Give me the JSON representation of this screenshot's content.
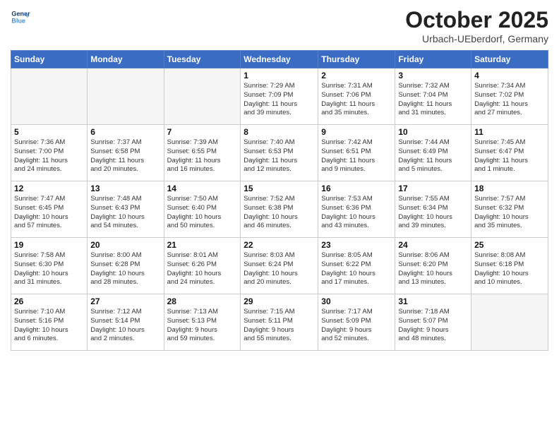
{
  "logo": {
    "text1": "General",
    "text2": "Blue"
  },
  "header": {
    "month": "October 2025",
    "location": "Urbach-UEberdorf, Germany"
  },
  "weekdays": [
    "Sunday",
    "Monday",
    "Tuesday",
    "Wednesday",
    "Thursday",
    "Friday",
    "Saturday"
  ],
  "weeks": [
    [
      {
        "day": "",
        "info": ""
      },
      {
        "day": "",
        "info": ""
      },
      {
        "day": "",
        "info": ""
      },
      {
        "day": "1",
        "info": "Sunrise: 7:29 AM\nSunset: 7:09 PM\nDaylight: 11 hours\nand 39 minutes."
      },
      {
        "day": "2",
        "info": "Sunrise: 7:31 AM\nSunset: 7:06 PM\nDaylight: 11 hours\nand 35 minutes."
      },
      {
        "day": "3",
        "info": "Sunrise: 7:32 AM\nSunset: 7:04 PM\nDaylight: 11 hours\nand 31 minutes."
      },
      {
        "day": "4",
        "info": "Sunrise: 7:34 AM\nSunset: 7:02 PM\nDaylight: 11 hours\nand 27 minutes."
      }
    ],
    [
      {
        "day": "5",
        "info": "Sunrise: 7:36 AM\nSunset: 7:00 PM\nDaylight: 11 hours\nand 24 minutes."
      },
      {
        "day": "6",
        "info": "Sunrise: 7:37 AM\nSunset: 6:58 PM\nDaylight: 11 hours\nand 20 minutes."
      },
      {
        "day": "7",
        "info": "Sunrise: 7:39 AM\nSunset: 6:55 PM\nDaylight: 11 hours\nand 16 minutes."
      },
      {
        "day": "8",
        "info": "Sunrise: 7:40 AM\nSunset: 6:53 PM\nDaylight: 11 hours\nand 12 minutes."
      },
      {
        "day": "9",
        "info": "Sunrise: 7:42 AM\nSunset: 6:51 PM\nDaylight: 11 hours\nand 9 minutes."
      },
      {
        "day": "10",
        "info": "Sunrise: 7:44 AM\nSunset: 6:49 PM\nDaylight: 11 hours\nand 5 minutes."
      },
      {
        "day": "11",
        "info": "Sunrise: 7:45 AM\nSunset: 6:47 PM\nDaylight: 11 hours\nand 1 minute."
      }
    ],
    [
      {
        "day": "12",
        "info": "Sunrise: 7:47 AM\nSunset: 6:45 PM\nDaylight: 10 hours\nand 57 minutes."
      },
      {
        "day": "13",
        "info": "Sunrise: 7:48 AM\nSunset: 6:43 PM\nDaylight: 10 hours\nand 54 minutes."
      },
      {
        "day": "14",
        "info": "Sunrise: 7:50 AM\nSunset: 6:40 PM\nDaylight: 10 hours\nand 50 minutes."
      },
      {
        "day": "15",
        "info": "Sunrise: 7:52 AM\nSunset: 6:38 PM\nDaylight: 10 hours\nand 46 minutes."
      },
      {
        "day": "16",
        "info": "Sunrise: 7:53 AM\nSunset: 6:36 PM\nDaylight: 10 hours\nand 43 minutes."
      },
      {
        "day": "17",
        "info": "Sunrise: 7:55 AM\nSunset: 6:34 PM\nDaylight: 10 hours\nand 39 minutes."
      },
      {
        "day": "18",
        "info": "Sunrise: 7:57 AM\nSunset: 6:32 PM\nDaylight: 10 hours\nand 35 minutes."
      }
    ],
    [
      {
        "day": "19",
        "info": "Sunrise: 7:58 AM\nSunset: 6:30 PM\nDaylight: 10 hours\nand 31 minutes."
      },
      {
        "day": "20",
        "info": "Sunrise: 8:00 AM\nSunset: 6:28 PM\nDaylight: 10 hours\nand 28 minutes."
      },
      {
        "day": "21",
        "info": "Sunrise: 8:01 AM\nSunset: 6:26 PM\nDaylight: 10 hours\nand 24 minutes."
      },
      {
        "day": "22",
        "info": "Sunrise: 8:03 AM\nSunset: 6:24 PM\nDaylight: 10 hours\nand 20 minutes."
      },
      {
        "day": "23",
        "info": "Sunrise: 8:05 AM\nSunset: 6:22 PM\nDaylight: 10 hours\nand 17 minutes."
      },
      {
        "day": "24",
        "info": "Sunrise: 8:06 AM\nSunset: 6:20 PM\nDaylight: 10 hours\nand 13 minutes."
      },
      {
        "day": "25",
        "info": "Sunrise: 8:08 AM\nSunset: 6:18 PM\nDaylight: 10 hours\nand 10 minutes."
      }
    ],
    [
      {
        "day": "26",
        "info": "Sunrise: 7:10 AM\nSunset: 5:16 PM\nDaylight: 10 hours\nand 6 minutes."
      },
      {
        "day": "27",
        "info": "Sunrise: 7:12 AM\nSunset: 5:14 PM\nDaylight: 10 hours\nand 2 minutes."
      },
      {
        "day": "28",
        "info": "Sunrise: 7:13 AM\nSunset: 5:13 PM\nDaylight: 9 hours\nand 59 minutes."
      },
      {
        "day": "29",
        "info": "Sunrise: 7:15 AM\nSunset: 5:11 PM\nDaylight: 9 hours\nand 55 minutes."
      },
      {
        "day": "30",
        "info": "Sunrise: 7:17 AM\nSunset: 5:09 PM\nDaylight: 9 hours\nand 52 minutes."
      },
      {
        "day": "31",
        "info": "Sunrise: 7:18 AM\nSunset: 5:07 PM\nDaylight: 9 hours\nand 48 minutes."
      },
      {
        "day": "",
        "info": ""
      }
    ]
  ]
}
